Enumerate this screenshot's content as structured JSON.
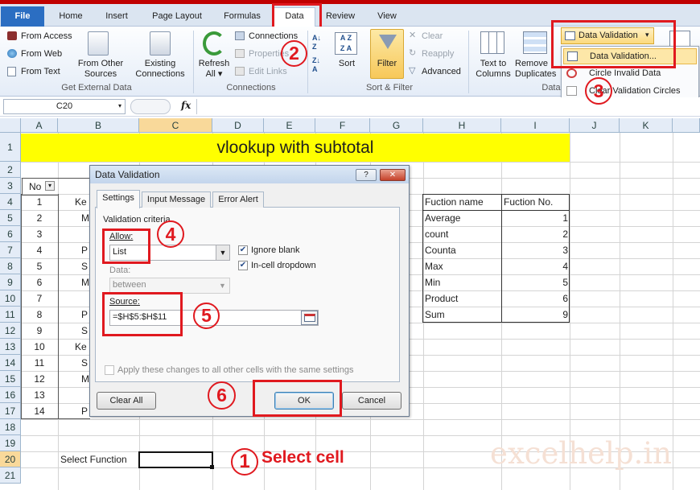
{
  "ribbon_tabs": {
    "file": "File",
    "home": "Home",
    "insert": "Insert",
    "page_layout": "Page Layout",
    "formulas": "Formulas",
    "data": "Data",
    "review": "Review",
    "view": "View"
  },
  "get_external": {
    "from_access": "From Access",
    "from_web": "From Web",
    "from_text": "From Text",
    "from_other_1": "From Other",
    "from_other_2": "Sources",
    "existing_1": "Existing",
    "existing_2": "Connections",
    "label": "Get External Data"
  },
  "connections": {
    "refresh_1": "Refresh",
    "refresh_2": "All",
    "connections": "Connections",
    "properties": "Properties",
    "edit_links": "Edit Links",
    "label": "Connections"
  },
  "sort_filter": {
    "sort": "Sort",
    "filter": "Filter",
    "clear": "Clear",
    "reapply": "Reapply",
    "advanced": "Advanced",
    "label": "Sort & Filter"
  },
  "data_tools": {
    "text_to_1": "Text to",
    "text_to_2": "Columns",
    "remove_1": "Remove",
    "remove_2": "Duplicates",
    "label_partial": "Data",
    "data_validation": "Data Validation"
  },
  "dv_menu": {
    "item1": "Data Validation...",
    "item2": "Circle Invalid Data",
    "item3": "Clear Validation Circles"
  },
  "formula_bar": {
    "name_box": "C20",
    "fx": "fx",
    "value": ""
  },
  "columns": [
    "A",
    "B",
    "C",
    "D",
    "E",
    "F",
    "G",
    "H",
    "I",
    "J",
    "K"
  ],
  "rows": [
    "1",
    "2",
    "3",
    "4",
    "5",
    "6",
    "7",
    "8",
    "9",
    "10",
    "11",
    "12",
    "13",
    "14",
    "15",
    "16",
    "17",
    "18",
    "19",
    "20",
    "21"
  ],
  "sheet": {
    "title": "vlookup with subtotal",
    "no_header": "No",
    "a_values": [
      "1",
      "2",
      "3",
      "4",
      "5",
      "6",
      "7",
      "8",
      "9",
      "10",
      "11",
      "12",
      "13",
      "14"
    ],
    "b_fragments": [
      "Ke",
      "M",
      "",
      "P",
      "S",
      "M",
      "",
      "P",
      "S",
      "Ke",
      "S",
      "M",
      "",
      "P"
    ],
    "select_function_label": "Select Function",
    "fn_table_headers": [
      "Fuction name",
      "Fuction No."
    ],
    "fn_table_rows": [
      [
        "Average",
        "1"
      ],
      [
        "count",
        "2"
      ],
      [
        "Counta",
        "3"
      ],
      [
        "Max",
        "4"
      ],
      [
        "Min",
        "5"
      ],
      [
        "Product",
        "6"
      ],
      [
        "Sum",
        "9"
      ]
    ]
  },
  "dialog": {
    "title": "Data Validation",
    "help": "?",
    "close": "✕",
    "tabs": [
      "Settings",
      "Input Message",
      "Error Alert"
    ],
    "criteria_label": "Validation criteria",
    "allow_label": "Allow:",
    "allow_value": "List",
    "ignore_blank": "Ignore blank",
    "in_cell_dropdown": "In-cell dropdown",
    "data_label": "Data:",
    "data_value": "between",
    "source_label": "Source:",
    "source_value": "=$H$5:$H$11",
    "apply_all": "Apply these changes to all other cells with the same settings",
    "clear_all": "Clear All",
    "ok": "OK",
    "cancel": "Cancel"
  },
  "annotations": {
    "step1": "1",
    "step1_text": "Select cell",
    "step2": "2",
    "step3": "3",
    "step4": "4",
    "step5": "5",
    "step6": "6"
  },
  "watermark": "excelhelp.in",
  "colors": {
    "accent_red": "#e0191f",
    "title_fill": "#ffff00",
    "file_tab": "#2b6ec2"
  }
}
